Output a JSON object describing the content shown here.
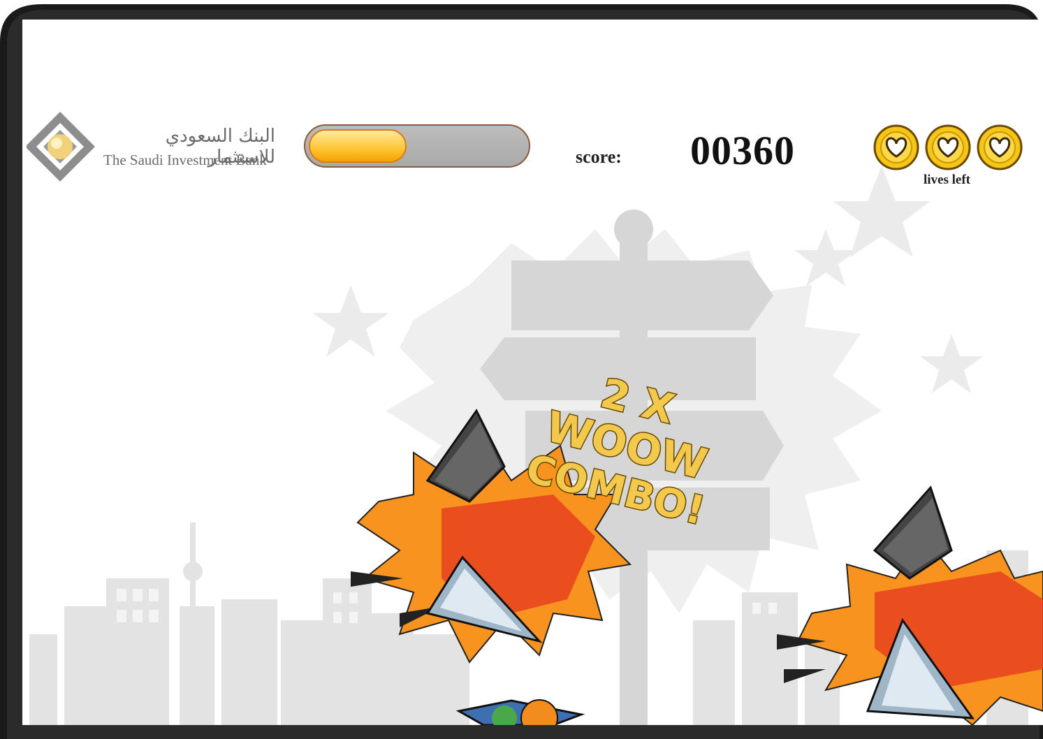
{
  "brand": {
    "name_ar": "البنك السعودي للاستثمار",
    "name_en": "The Saudi Investment Bank",
    "logo_icon": "sib-diamond-logo-icon"
  },
  "hud": {
    "progress": 0.45,
    "score_label": "score:",
    "score_value": "00360",
    "lives_count": 3,
    "lives_label": "lives left",
    "heart_icon": "heart-icon"
  },
  "combo": {
    "line1": "2 X",
    "line2": "WOOW",
    "line3": "COMBO!"
  },
  "colors": {
    "accent_gold": "#f2c94c",
    "burst_orange": "#f7931e",
    "burst_red": "#e8411e",
    "skyline_gray": "#e3e3e3"
  }
}
